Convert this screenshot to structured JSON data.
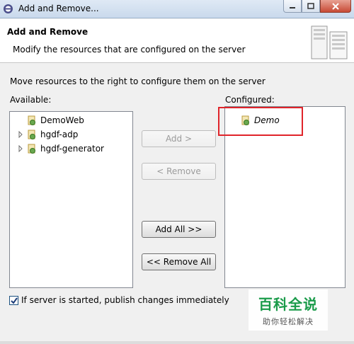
{
  "window": {
    "title": "Add and Remove..."
  },
  "header": {
    "title": "Add and Remove",
    "description": "Modify the resources that are configured on the server"
  },
  "instruction": "Move resources to the right to configure them on the server",
  "available": {
    "label": "Available:",
    "items": [
      {
        "label": "DemoWeb",
        "expandable": false
      },
      {
        "label": "hgdf-adp",
        "expandable": true
      },
      {
        "label": "hgdf-generator",
        "expandable": true
      }
    ]
  },
  "configured": {
    "label": "Configured:",
    "items": [
      {
        "label": "Demo"
      }
    ]
  },
  "buttons": {
    "add": "Add >",
    "remove": "< Remove",
    "add_all": "Add All >>",
    "remove_all": "<< Remove All"
  },
  "publish": {
    "label": "If server is started, publish changes immediately",
    "checked": true
  },
  "watermark": {
    "main": "百科全说",
    "sub": "助你轻松解决"
  },
  "colors": {
    "highlight": "#e0242a",
    "watermark_green": "#1a9b4a"
  }
}
